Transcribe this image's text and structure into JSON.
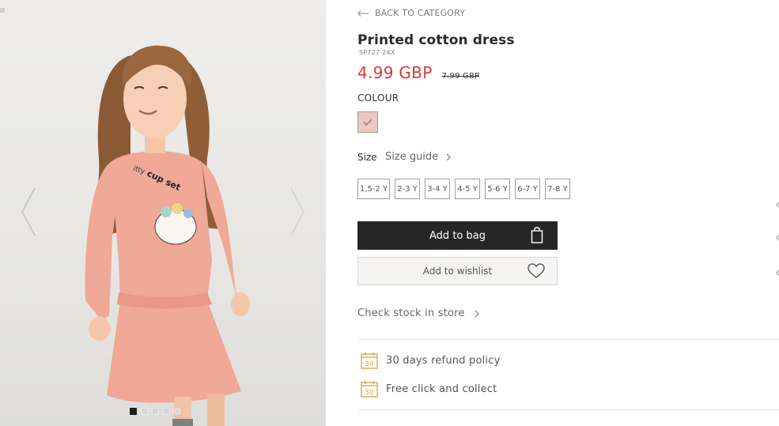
{
  "back": {
    "label": "BACK TO CATEGORY"
  },
  "product": {
    "title": "Printed cotton dress",
    "sku": "SP727-24X",
    "price": "4.99 GBP",
    "old_price": "7.99 GBP"
  },
  "colour": {
    "label": "COLOUR",
    "selected_swatch": "#e9c9c1"
  },
  "size": {
    "label": "Size",
    "guide_label": "Size guide",
    "options": [
      "1,5-2 Y",
      "2-3 Y",
      "3-4 Y",
      "4-5 Y",
      "5-6 Y",
      "6-7 Y",
      "7-8 Y"
    ]
  },
  "actions": {
    "add_to_bag": "Add to bag",
    "add_to_wishlist": "Add to wishlist"
  },
  "stock": {
    "label": "Check stock in store"
  },
  "info": [
    {
      "label": "30 days refund policy",
      "icon": "calendar-30-icon",
      "badge": "30"
    },
    {
      "label": "Free click and collect",
      "icon": "calendar-30-icon",
      "badge": "30"
    }
  ],
  "colors": {
    "price": "#e0353c",
    "accent_icon": "#d9a13a",
    "button_dark": "#262626"
  }
}
